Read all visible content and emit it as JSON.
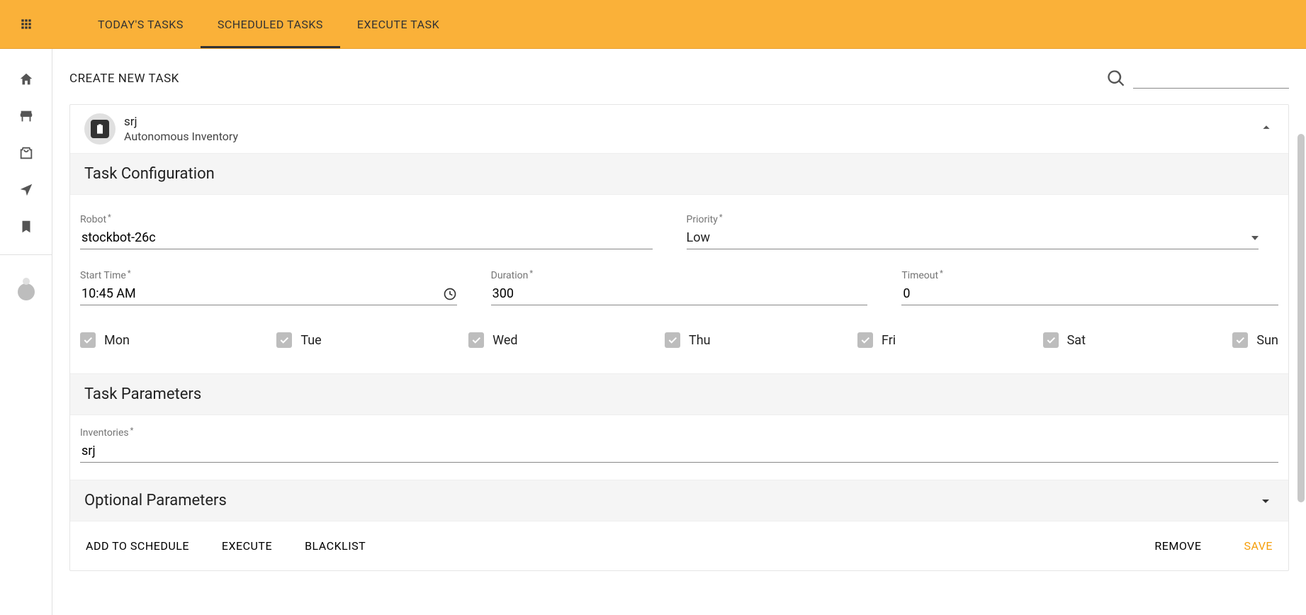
{
  "tabs": {
    "todays": "TODAY'S TASKS",
    "scheduled": "SCHEDULED TASKS",
    "execute": "EXECUTE TASK"
  },
  "header": {
    "title": "CREATE NEW TASK"
  },
  "task": {
    "name": "srj",
    "subtitle": "Autonomous Inventory"
  },
  "sections": {
    "config": "Task Configuration",
    "params": "Task Parameters",
    "optional": "Optional Parameters"
  },
  "form": {
    "robot_label": "Robot",
    "robot_value": "stockbot-26c",
    "priority_label": "Priority",
    "priority_value": "Low",
    "start_label": "Start Time",
    "start_value": "10:45 AM",
    "duration_label": "Duration",
    "duration_value": "300",
    "timeout_label": "Timeout",
    "timeout_value": "0",
    "inventories_label": "Inventories",
    "inventories_value": "srj"
  },
  "days": {
    "mon": "Mon",
    "tue": "Tue",
    "wed": "Wed",
    "thu": "Thu",
    "fri": "Fri",
    "sat": "Sat",
    "sun": "Sun"
  },
  "actions": {
    "add": "ADD TO SCHEDULE",
    "execute": "EXECUTE",
    "blacklist": "BLACKLIST",
    "remove": "REMOVE",
    "save": "SAVE"
  }
}
